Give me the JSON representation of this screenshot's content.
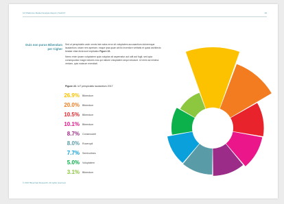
{
  "header": {
    "title": "IoT Platforms Market Analysis Report | TechNY",
    "page_number": "26"
  },
  "section": {
    "heading": "Duis non purus Bibendum per Cigher",
    "paragraphs": [
      "Sed ut perspiciatis unde omnis iste natus error sit voluptatem accusantium doloremque laudantium, totam rem aperiam, eaque ipsa quae ab illo inventore veritatis et quasi architecto beatae vitae dicta sunt explicabo",
      "Nemo enim ipsam voluptatem quia voluptas sit aspernatur aut odit aut fugit, sed quia consequuntur magni dolores eos qui ratione voluptatem sequi nesciunt. Ut enim ad minima veniam, quis nostrum exercitati."
    ],
    "figure_ref": "Figure 22."
  },
  "figure": {
    "label": "Figure 22.",
    "caption": "IoT perspiciatis laudantium 2017"
  },
  "chart_data": {
    "type": "pie",
    "title": "IoT perspiciatis laudantium 2017",
    "slices": [
      {
        "label": "Bibendum",
        "value": 26.9,
        "display": "26.9%",
        "color": "#fcc200"
      },
      {
        "label": "Bibendum",
        "value": 20.0,
        "display": "20.0%",
        "color": "#f47c20"
      },
      {
        "label": "Bibendum",
        "value": 10.5,
        "display": "10.5%",
        "color": "#e8232b"
      },
      {
        "label": "Bibendum",
        "value": 10.1,
        "display": "10.1%",
        "color": "#ea168a"
      },
      {
        "label": "Consecuanti",
        "value": 8.7,
        "display": "8.7%",
        "color": "#9b2c87"
      },
      {
        "label": "Ruverquil",
        "value": 8.0,
        "display": "8.0%",
        "color": "#5a9ba8"
      },
      {
        "label": "Semivultnes",
        "value": 7.7,
        "display": "7.7%",
        "color": "#0aa0db"
      },
      {
        "label": "Voluptatem",
        "value": 5.0,
        "display": "5.0%",
        "color": "#0db14b"
      },
      {
        "label": "Bibendum",
        "value": 3.1,
        "display": "3.1%",
        "color": "#8dc63f"
      }
    ]
  },
  "footer": {
    "text": "© 2017 Bluechart Research. All rights reserved."
  }
}
